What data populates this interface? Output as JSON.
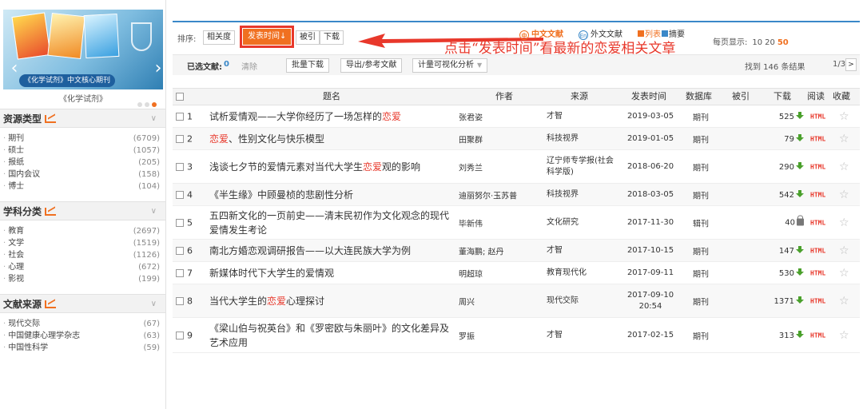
{
  "sidebar": {
    "banner_caption": "《化学试剂》中文核心期刊",
    "journal_title": "《化学试剂》",
    "groups": [
      {
        "title": "资源类型",
        "items": [
          {
            "label": "期刊",
            "count": "(6709)"
          },
          {
            "label": "硕士",
            "count": "(1057)"
          },
          {
            "label": "报纸",
            "count": "(205)"
          },
          {
            "label": "国内会议",
            "count": "(158)"
          },
          {
            "label": "博士",
            "count": "(104)"
          }
        ]
      },
      {
        "title": "学科分类",
        "items": [
          {
            "label": "教育",
            "count": "(2697)"
          },
          {
            "label": "文学",
            "count": "(1519)"
          },
          {
            "label": "社会",
            "count": "(1126)"
          },
          {
            "label": "心理",
            "count": "(672)"
          },
          {
            "label": "影视",
            "count": "(199)"
          }
        ]
      },
      {
        "title": "文献来源",
        "items": [
          {
            "label": "现代交际",
            "count": "(67)"
          },
          {
            "label": "中国健康心理学杂志",
            "count": "(63)"
          },
          {
            "label": "中国性科学",
            "count": "(59)"
          }
        ]
      }
    ]
  },
  "sortbar": {
    "label": "排序:",
    "relevance": "相关度",
    "time": "发表时间",
    "time_arrow": "↓",
    "cited": "被引",
    "download": "下载"
  },
  "annotation": "点击“发表时间”看最新的恋爱相关文章",
  "lang_tabs": {
    "cn": "中文文献",
    "cn_icon": "中",
    "en": "外文文献",
    "en_icon": "En"
  },
  "views": {
    "list": "列表",
    "abstract": "摘要"
  },
  "perpage": {
    "label": "每页显示:",
    "options": [
      "10",
      "20",
      "50"
    ],
    "active": "50"
  },
  "selection": {
    "label": "已选文献:",
    "count": "0",
    "clear": "清除",
    "batch_download": "批量下载",
    "export": "导出/参考文献",
    "visual": "计量可视化分析",
    "dropdown_icon": "▼"
  },
  "results": {
    "found": "找到 146 条结果",
    "page": "1/3",
    "next": ">"
  },
  "table": {
    "columns": {
      "title": "题名",
      "author": "作者",
      "source": "来源",
      "date": "发表时间",
      "db": "数据库",
      "cited": "被引",
      "download": "下载",
      "read": "阅读",
      "fav": "收藏"
    },
    "read_label": "HTML",
    "fav_icon": "☆",
    "rows": [
      {
        "num": "1",
        "title_pre": "试析爱情观——大学你经历了一场怎样的",
        "title_hl": "恋爱",
        "title_post": "",
        "author": "张君姿",
        "source": "才智",
        "date": "2019-03-05",
        "db": "期刊",
        "downloads": "525",
        "locked": false
      },
      {
        "num": "2",
        "title_pre": "",
        "title_hl": "恋爱",
        "title_post": "、性别文化与快乐模型",
        "author": "田聚群",
        "source": "科技视界",
        "date": "2019-01-05",
        "db": "期刊",
        "downloads": "79",
        "locked": false
      },
      {
        "num": "3",
        "title_pre": "浅谈七夕节的爱情元素对当代大学生",
        "title_hl": "恋爱",
        "title_post": "观的影响",
        "author": "刘秀兰",
        "source": "辽宁师专学报(社会科学版)",
        "date": "2018-06-20",
        "db": "期刊",
        "downloads": "290",
        "locked": false
      },
      {
        "num": "4",
        "title_pre": "《半生缘》中顾曼桢的悲剧性分析",
        "title_hl": "",
        "title_post": "",
        "author": "迪丽努尔·玉苏普",
        "source": "科技视界",
        "date": "2018-03-05",
        "db": "期刊",
        "downloads": "542",
        "locked": false
      },
      {
        "num": "5",
        "title_pre": "五四新文化的一页前史——清末民初作为文化观念的现代爱情发生考论",
        "title_hl": "",
        "title_post": "",
        "author": "毕新伟",
        "source": "文化研究",
        "date": "2017-11-30",
        "db": "辑刊",
        "downloads": "40",
        "locked": true
      },
      {
        "num": "6",
        "title_pre": "南北方婚恋观调研报告——以大连民族大学为例",
        "title_hl": "",
        "title_post": "",
        "author": "董海鹏; 赵丹",
        "source": "才智",
        "date": "2017-10-15",
        "db": "期刊",
        "downloads": "147",
        "locked": false
      },
      {
        "num": "7",
        "title_pre": "新媒体时代下大学生的爱情观",
        "title_hl": "",
        "title_post": "",
        "author": "明超琼",
        "source": "教育现代化",
        "date": "2017-09-11",
        "db": "期刊",
        "downloads": "530",
        "locked": false
      },
      {
        "num": "8",
        "title_pre": "当代大学生的",
        "title_hl": "恋爱",
        "title_post": "心理探讨",
        "author": "周兴",
        "source": "现代交际",
        "date": "2017-09-10 20:54",
        "db": "期刊",
        "downloads": "1371",
        "locked": false
      },
      {
        "num": "9",
        "title_pre": "《梁山伯与祝英台》和《罗密欧与朱丽叶》的文化差异及艺术应用",
        "title_hl": "",
        "title_post": "",
        "author": "罗振",
        "source": "才智",
        "date": "2017-02-15",
        "db": "期刊",
        "downloads": "313",
        "locked": false
      }
    ]
  }
}
